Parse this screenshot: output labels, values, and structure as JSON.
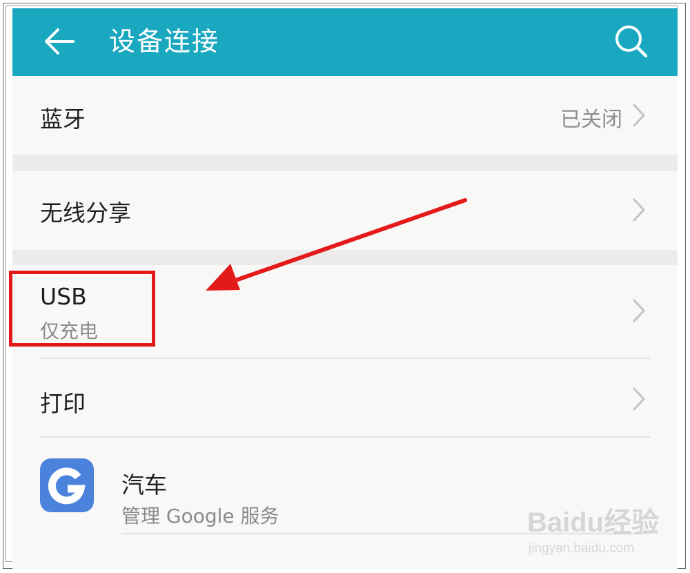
{
  "header": {
    "title": "设备连接",
    "back_icon": "arrow-left-icon",
    "search_icon": "search-icon",
    "bar_color": "#1aa8c0"
  },
  "rows": {
    "bluetooth": {
      "label": "蓝牙",
      "value": "已关闭"
    },
    "wireless_share": {
      "label": "无线分享"
    },
    "usb": {
      "label": "USB",
      "sublabel": "仅充电"
    },
    "print": {
      "label": "打印"
    },
    "car": {
      "label": "汽车",
      "sublabel": "管理 Google 服务",
      "icon": "google-g-icon",
      "icon_color": "#4a82dc"
    }
  },
  "annotation": {
    "highlight_color": "#e21a1a"
  },
  "watermark": {
    "brand": "Baidu经验",
    "url": "jingyan.baidu.com"
  }
}
